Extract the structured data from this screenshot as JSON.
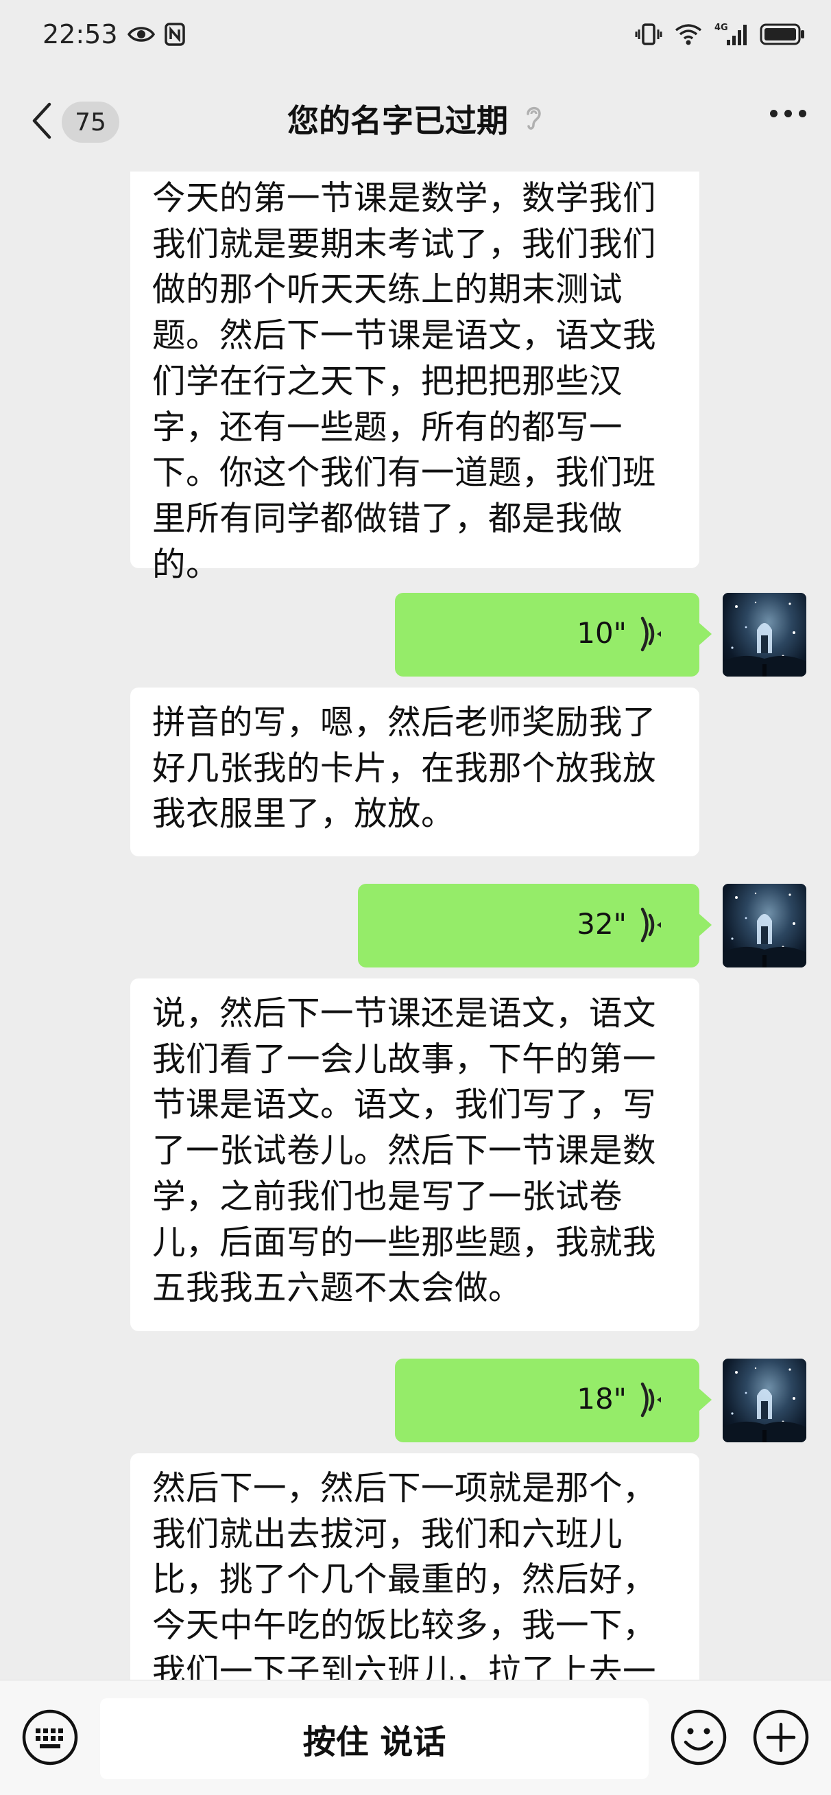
{
  "status_bar": {
    "time": "22:53",
    "network_label": "4G"
  },
  "header": {
    "unread_count": "75",
    "title": "您的名字已过期"
  },
  "messages": [
    {
      "type": "text",
      "text": "今天的第一节课是数学，数学我们我们就是要期末考试了，我们我们做的那个听天天练上的期末测试题。然后下一节课是语文，语文我们学在行之天下，把把把那些汉字，还有一些题，所有的都写一下。你这个我们有一道题，我们班里所有同学都做错了，都是我做的。"
    },
    {
      "type": "voice",
      "duration": "10\""
    },
    {
      "type": "text",
      "text": "拼音的写，嗯，然后老师奖励我了好几张我的卡片，在我那个放我放我衣服里了，放放。"
    },
    {
      "type": "voice",
      "duration": "32\""
    },
    {
      "type": "text",
      "text": "说，然后下一节课还是语文，语文我们看了一会儿故事，下午的第一节课是语文。语文，我们写了，写了一张试卷儿。然后下一节课是数学，之前我们也是写了一张试卷儿，后面写的一些那些题，我就我五我我五六题不太会做。"
    },
    {
      "type": "voice",
      "duration": "18\""
    },
    {
      "type": "text",
      "text": "然后下一，然后下一项就是那个，我们就出去拔河，我们和六班儿比，挑了个几个最重的，然后好，今天中午吃的饭比较多，我一下，我们一下子到六班儿，拉了上去一下"
    }
  ],
  "input_bar": {
    "hold_to_talk": "按住 说话"
  },
  "colors": {
    "background": "#ededed",
    "voice_bubble": "#95ec69",
    "text_bubble": "#ffffff"
  }
}
